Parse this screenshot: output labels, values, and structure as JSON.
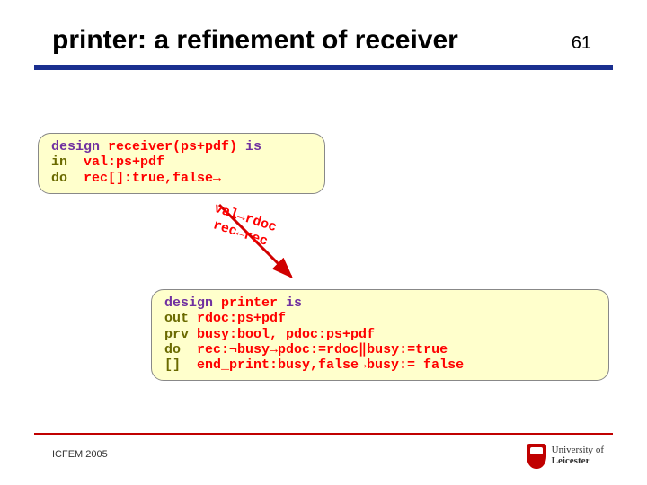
{
  "header": {
    "title": "printer: a refinement of receiver",
    "page_number": "61"
  },
  "receiver_box": {
    "design_kw": "design",
    "design_name": " receiver(ps+pdf) ",
    "is_kw": "is",
    "in_kw": "in",
    "in_decl": "  val:ps+pdf",
    "do_kw": "do",
    "do_decl": "  rec[]:true,false→"
  },
  "arrow": {
    "line1": "val→rdoc",
    "line2": "rec←rec"
  },
  "printer_box": {
    "design_kw": "design",
    "design_name": " printer ",
    "is_kw": "is",
    "out_kw": "out",
    "out_decl": " rdoc:ps+pdf",
    "prv_kw": "prv",
    "prv_decl": " busy:bool, pdoc:ps+pdf",
    "do_kw": "do",
    "do_decl": "  rec:¬busy→pdoc:=rdoc‖busy:=true",
    "alt_kw": "[]",
    "alt_decl": "  end_print:busy,false→busy:= false"
  },
  "footer": {
    "left": "ICFEM 2005",
    "logo_line1": "University of",
    "logo_line2": "Leicester"
  }
}
